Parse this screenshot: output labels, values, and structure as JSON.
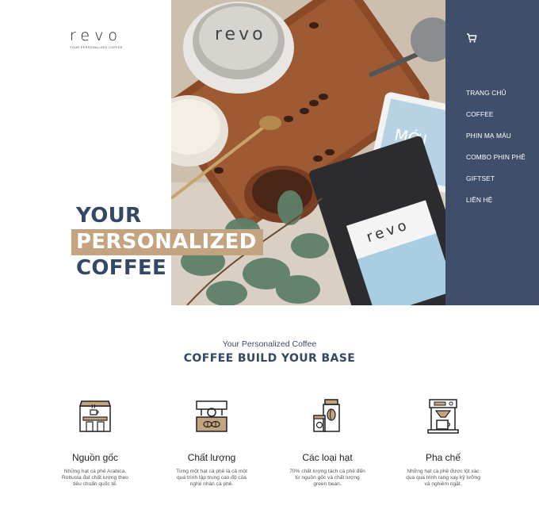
{
  "brand": {
    "name": "revo",
    "tagline": "your personalized coffee"
  },
  "nav": {
    "cart_icon": "cart-icon",
    "items": [
      "TRANG CHỦ",
      "COFFEE",
      "PHIN MẠ MÀU",
      "COMBO PHIN PHÊ",
      "GIFTSET",
      "LIÊN HỆ"
    ]
  },
  "hero": {
    "line1": "YOUR",
    "line2": "PERSONALIZED",
    "line3": "COFFEE",
    "image_alt": "Coffee phin, beans and revo coffee bag on a wooden tray"
  },
  "section": {
    "subtitle": "Your Personalized Coffee",
    "title": "COFFEE BUILD YOUR BASE"
  },
  "features": [
    {
      "icon": "coffee-shop-icon",
      "title": "Nguồn gốc",
      "text": "Những hạt cà phê Arabica, Robusta đạt chất lượng theo tiêu chuẩn quốc tế."
    },
    {
      "icon": "roasting-machine-icon",
      "title": "Chất lượng",
      "text": "Từng một hạt cà phê là cả một quá trình tập trung cao độ của nghệ nhân cà phê."
    },
    {
      "icon": "coffee-bag-icon",
      "title": "Các loại hạt",
      "text": "70% chất lượng tách cà phê đến từ nguồn gốc và chất lượng green bean."
    },
    {
      "icon": "coffee-maker-icon",
      "title": "Pha chế",
      "text": "Những hạt cà phê được lột xác qua quá trình rang xay kỹ lưỡng và nghiêm ngặt."
    }
  ],
  "colors": {
    "navy": "#3f4f6b",
    "heading": "#334866",
    "accent": "#c4a381"
  }
}
